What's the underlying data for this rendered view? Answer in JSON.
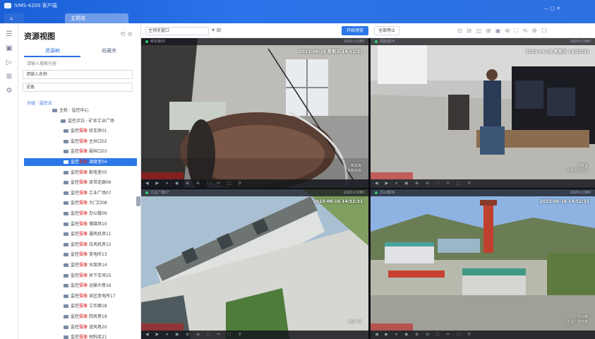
{
  "titlebar": {
    "app_title": "iVMS-4200 客户端",
    "tabs": [
      "",
      "主预览"
    ],
    "window_controls": "— ▢ ✕"
  },
  "rail": {
    "icons": [
      "menu-icon",
      "camera-icon",
      "playback-icon",
      "grid-icon",
      "settings-icon"
    ]
  },
  "left_panel": {
    "title": "资源视图",
    "tools": "⟲ ≡",
    "subtabs": [
      "资源树",
      "收藏夹"
    ],
    "crumb": "请输入搜索内容",
    "field1": "请输入名称",
    "field2": "设备",
    "group_label": "分组 · 监控点",
    "tree_items": [
      {
        "indent": 74,
        "text": "主机 · 监控中心",
        "red": ""
      },
      {
        "indent": 86,
        "text": "监控点位 · 矿井工业广场",
        "red": ""
      },
      {
        "indent": 90,
        "text": "监控",
        "red": "摄像",
        "rest": " 绞车房01"
      },
      {
        "indent": 90,
        "text": "监控",
        "red": "摄像",
        "rest": " 主井口02"
      },
      {
        "indent": 90,
        "text": "监控",
        "red": "摄像",
        "rest": " 副井口03"
      },
      {
        "indent": 90,
        "text": "监控",
        "red": "摄像",
        "rest": " 调度室04",
        "selected": true
      },
      {
        "indent": 90,
        "text": "监控",
        "red": "摄像",
        "rest": " 配电室05"
      },
      {
        "indent": 90,
        "text": "监控",
        "red": "摄像",
        "rest": " 皮带走廊06"
      },
      {
        "indent": 90,
        "text": "监控",
        "red": "摄像",
        "rest": " 工业广场07"
      },
      {
        "indent": 90,
        "text": "监控",
        "red": "摄像",
        "rest": " 大门口08"
      },
      {
        "indent": 90,
        "text": "监控",
        "red": "摄像",
        "rest": " 办公楼09"
      },
      {
        "indent": 90,
        "text": "监控",
        "red": "摄像",
        "rest": " 储煤场10"
      },
      {
        "indent": 90,
        "text": "监控",
        "red": "摄像",
        "rest": " 通风机房11"
      },
      {
        "indent": 90,
        "text": "监控",
        "red": "摄像",
        "rest": " 压风机房12"
      },
      {
        "indent": 90,
        "text": "监控",
        "red": "摄像",
        "rest": " 变电所13"
      },
      {
        "indent": 90,
        "text": "监控",
        "red": "摄像",
        "rest": " 水泵房14"
      },
      {
        "indent": 90,
        "text": "监控",
        "red": "摄像",
        "rest": " 井下车场15"
      },
      {
        "indent": 90,
        "text": "监控",
        "red": "摄像",
        "rest": " 运输大巷16"
      },
      {
        "indent": 90,
        "text": "监控",
        "red": "摄像",
        "rest": " 采区变电所17"
      },
      {
        "indent": 90,
        "text": "监控",
        "red": "摄像",
        "rest": " 工作面18"
      },
      {
        "indent": 90,
        "text": "监控",
        "red": "摄像",
        "rest": " 回风巷19"
      },
      {
        "indent": 90,
        "text": "监控",
        "red": "摄像",
        "rest": " 进风巷20"
      },
      {
        "indent": 90,
        "text": "监控",
        "red": "摄像",
        "rest": " 材料库21"
      }
    ]
  },
  "toolbar": {
    "select_value": "主预览窗口",
    "select2": "▾  ⊞",
    "primary_label": "开始预览",
    "secondary_label": "全部停止",
    "icons": "⊡ ⊟ ◫ ⊞ ▣ ⧉ ⛶ ⟲ ⚙ ☐"
  },
  "tiles": [
    {
      "name": "绞车房01",
      "status": "1920×1080",
      "timestamp": "2023-06-16 星期五 14:52:31",
      "osd1": "绞车房",
      "osd2": "主井绞车房"
    },
    {
      "name": "调度室04",
      "status": "1920×1080",
      "timestamp": "2023-06-16 星期五 14:52:31",
      "osd1": "调度室",
      "osd2": "调度中心监控"
    },
    {
      "name": "工业广场07",
      "status": "1920×1080",
      "timestamp": "2023-06-16 14:52:31",
      "osd1": "工业广场",
      "osd2": ""
    },
    {
      "name": "办公楼09",
      "status": "1920×1080",
      "timestamp": "2023-06-16 14:52:31",
      "osd1": "办公楼",
      "osd2": "工业广场全景"
    }
  ],
  "tile_controls": "◀ ▶ ⏸ ◉ ⊕ ⊖ ⛶ ✂ ⬚ ⚲"
}
